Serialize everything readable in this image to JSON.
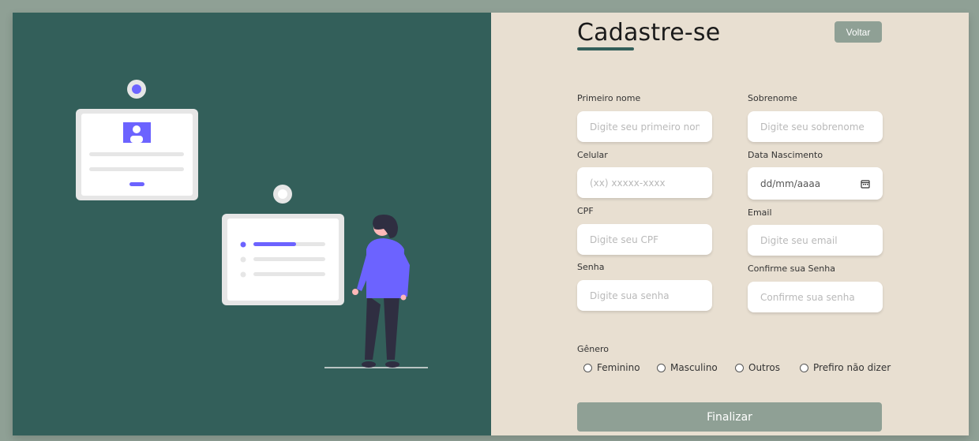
{
  "header": {
    "title": "Cadastre-se",
    "back_label": "Voltar"
  },
  "fields": {
    "first_name": {
      "label": "Primeiro nome",
      "placeholder": "Digite seu primeiro nome"
    },
    "last_name": {
      "label": "Sobrenome",
      "placeholder": "Digite seu sobrenome"
    },
    "phone": {
      "label": "Celular",
      "placeholder": "(xx) xxxxx-xxxx"
    },
    "birth_date": {
      "label": "Data Nascimento",
      "value": "dd/mm/aaaa"
    },
    "cpf": {
      "label": "CPF",
      "placeholder": "Digite seu CPF"
    },
    "email": {
      "label": "Email",
      "placeholder": "Digite seu email"
    },
    "password": {
      "label": "Senha",
      "placeholder": "Digite sua senha"
    },
    "confirm_password": {
      "label": "Confirme sua Senha",
      "placeholder": "Confirme sua senha"
    }
  },
  "gender": {
    "label": "Gênero",
    "options": [
      "Feminino",
      "Masculino",
      "Outros",
      "Prefiro não dizer"
    ]
  },
  "submit_label": "Finalizar",
  "colors": {
    "background": "#8fa095",
    "left_panel": "#335f5a",
    "right_panel": "#e8dfd1",
    "accent": "#6c63ff"
  },
  "icons": [
    "calendar-icon",
    "illustration-person-cards"
  ]
}
